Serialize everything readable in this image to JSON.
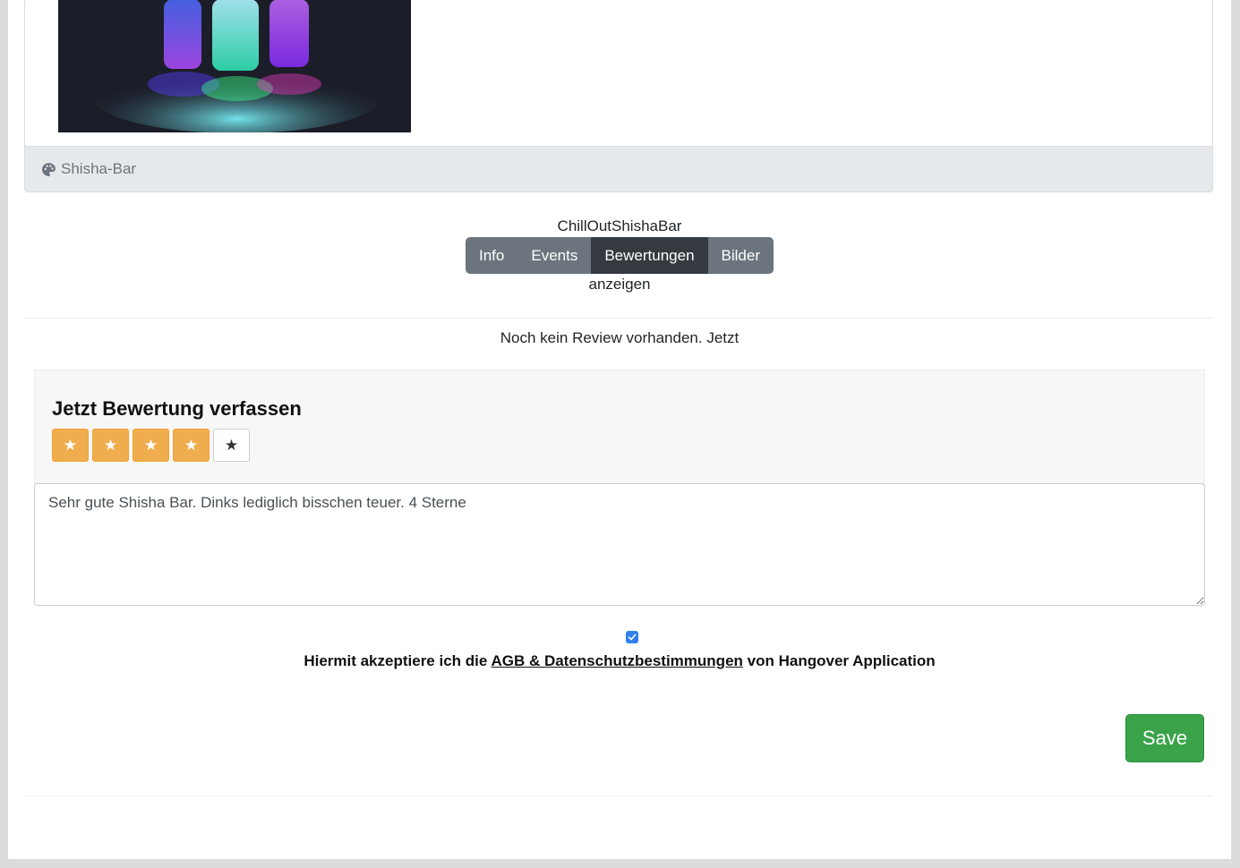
{
  "card": {
    "category_label": "Shisha-Bar",
    "category_icon": "palette-icon"
  },
  "venue": {
    "name": "ChillOutShishaBar"
  },
  "tabs": [
    {
      "label": "Info",
      "active": false
    },
    {
      "label": "Events",
      "active": false
    },
    {
      "label": "Bewertungen",
      "active": true
    },
    {
      "label": "Bilder",
      "active": false
    }
  ],
  "tabs_caption": "anzeigen",
  "reviews": {
    "empty_message": "Noch kein Review vorhanden. Jetzt"
  },
  "review_form": {
    "title": "Jetzt Bewertung verfassen",
    "rating": 4,
    "max_rating": 5,
    "star_glyph": "★",
    "text": "Sehr gute Shisha Bar. Dinks lediglich bisschen teuer. 4 Sterne",
    "terms_prefix": "Hiermit akzeptiere ich die",
    "terms_link": "AGB & Datenschutzbestimmungen",
    "terms_suffix": "von Hangover Application",
    "terms_accepted": true,
    "save_label": "Save"
  },
  "colors": {
    "star_active": "#f0ad4e",
    "tab_default": "#6c757d",
    "tab_active": "#343a40",
    "save_button": "#3aa34a",
    "checkbox": "#2f7ff0"
  }
}
